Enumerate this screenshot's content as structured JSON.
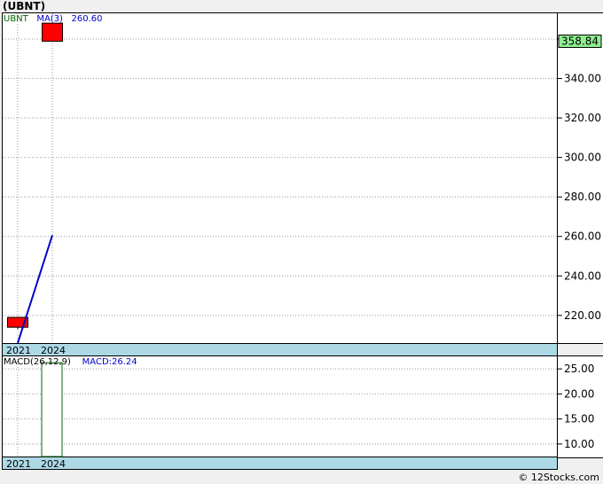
{
  "title": "(UBNT)",
  "price_panel": {
    "legend_ticker": "UBNT",
    "legend_ma": "MA(3)",
    "legend_ma_value": "260.60",
    "last_price_label": "358.84"
  },
  "macd_panel": {
    "legend_label": "MACD(26,12,9)",
    "legend_value": "MACD:26.24"
  },
  "x_labels": [
    "2021",
    "2024"
  ],
  "footer": "© 12Stocks.com",
  "colors": {
    "candle_down": "#ff0000",
    "ma_line": "#0000cc",
    "macd_bar": "#006600",
    "last_price_bg": "#90ee90",
    "axis_strip": "#add8e6",
    "ticker_text": "#006600",
    "ma_text": "#0000cc"
  },
  "chart_data": [
    {
      "type": "candlestick",
      "x": [
        "2021",
        "2024"
      ],
      "ohlc": [
        {
          "x": "2021",
          "open": 219,
          "high": 219,
          "low": 213,
          "close": 214
        },
        {
          "x": "2024",
          "open": 368,
          "high": 368,
          "low": 358.84,
          "close": 358.84
        }
      ],
      "overlay": {
        "name": "MA(3)",
        "points": [
          {
            "x": "2021",
            "y": 206
          },
          {
            "x": "2024",
            "y": 260.6
          }
        ]
      },
      "y_ticks": [
        220,
        240,
        260,
        280,
        300,
        320,
        340,
        360
      ],
      "y_tick_labels": [
        "220.00",
        "240.00",
        "260.00",
        "280.00",
        "300.00",
        "320.00",
        "340.00",
        "360.00"
      ],
      "ylim": [
        206,
        373
      ],
      "grid": true
    },
    {
      "type": "bar",
      "categories": [
        "2021",
        "2024"
      ],
      "values": [
        0,
        26.24
      ],
      "y_ticks": [
        10,
        15,
        20,
        25
      ],
      "y_tick_labels": [
        "10.00",
        "15.00",
        "20.00",
        "25.00"
      ],
      "ylim": [
        7.5,
        27.5
      ],
      "grid": true
    }
  ]
}
